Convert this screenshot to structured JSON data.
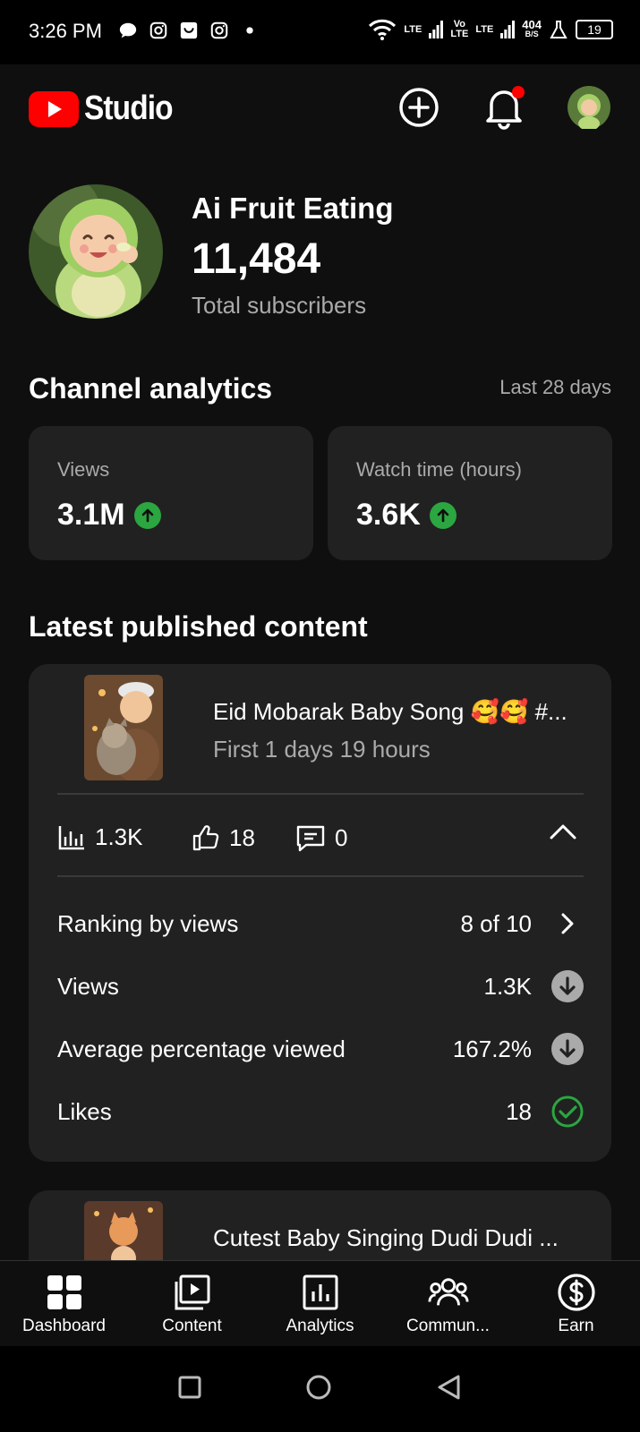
{
  "status_bar": {
    "time": "3:26 PM",
    "network_speed_value": "404",
    "network_speed_unit": "B/S",
    "lte1": "LTE",
    "volte_top": "Vo",
    "volte_bottom": "LTE",
    "lte2": "LTE",
    "battery": "19"
  },
  "app_bar": {
    "logo_text": "Studio"
  },
  "channel": {
    "name": "Ai Fruit Eating",
    "subscribers": "11,484",
    "subscribers_label": "Total subscribers"
  },
  "analytics": {
    "title": "Channel analytics",
    "range": "Last 28 days",
    "metrics": [
      {
        "label": "Views",
        "value": "3.1M"
      },
      {
        "label": "Watch time (hours)",
        "value": "3.6K"
      }
    ]
  },
  "latest": {
    "title": "Latest published content",
    "video": {
      "title": "Eid Mobarak Baby Song 🥰🥰 #...",
      "subtitle": "First 1 days 19 hours",
      "views": "1.3K",
      "likes": "18",
      "comments": "0",
      "rows": [
        {
          "label": "Ranking by views",
          "value": "8 of 10"
        },
        {
          "label": "Views",
          "value": "1.3K"
        },
        {
          "label": "Average percentage viewed",
          "value": "167.2%"
        },
        {
          "label": "Likes",
          "value": "18"
        }
      ]
    },
    "next_video": {
      "title": "Cutest Baby Singing Dudi Dudi ..."
    }
  },
  "bottom_nav": [
    {
      "label": "Dashboard"
    },
    {
      "label": "Content"
    },
    {
      "label": "Analytics"
    },
    {
      "label": "Commun..."
    },
    {
      "label": "Earn"
    }
  ],
  "colors": {
    "background": "#0f0f0f",
    "card": "#212121",
    "brand_red": "#ff0000",
    "up_green": "#2ba640",
    "check_green": "#2ba640",
    "secondary_text": "#aaaaaa"
  }
}
